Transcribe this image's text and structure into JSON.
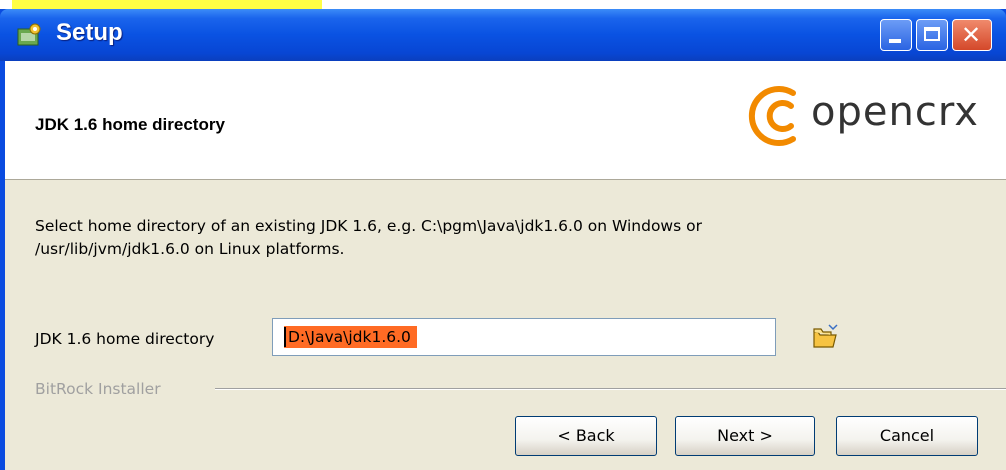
{
  "window": {
    "title": "Setup"
  },
  "header": {
    "title": "JDK 1.6 home directory",
    "brand": "opencrx",
    "brand_color": "#f28a00"
  },
  "body": {
    "description_line1": "Select home directory of an existing JDK 1.6, e.g. C:\\pgm\\Java\\jdk1.6.0 on Windows or",
    "description_line2": "/usr/lib/jvm/jdk1.6.0 on Linux platforms.",
    "field_label": "JDK 1.6 home directory",
    "field_value": "D:\\Java\\jdk1.6.0",
    "browse_icon": "folder-open-icon",
    "group_label": "BitRock Installer"
  },
  "buttons": {
    "back": "< Back",
    "next": "Next >",
    "cancel": "Cancel"
  },
  "colors": {
    "titlebar": "#0a52e2",
    "selection": "#ff6b24",
    "client": "#ece9d8"
  }
}
